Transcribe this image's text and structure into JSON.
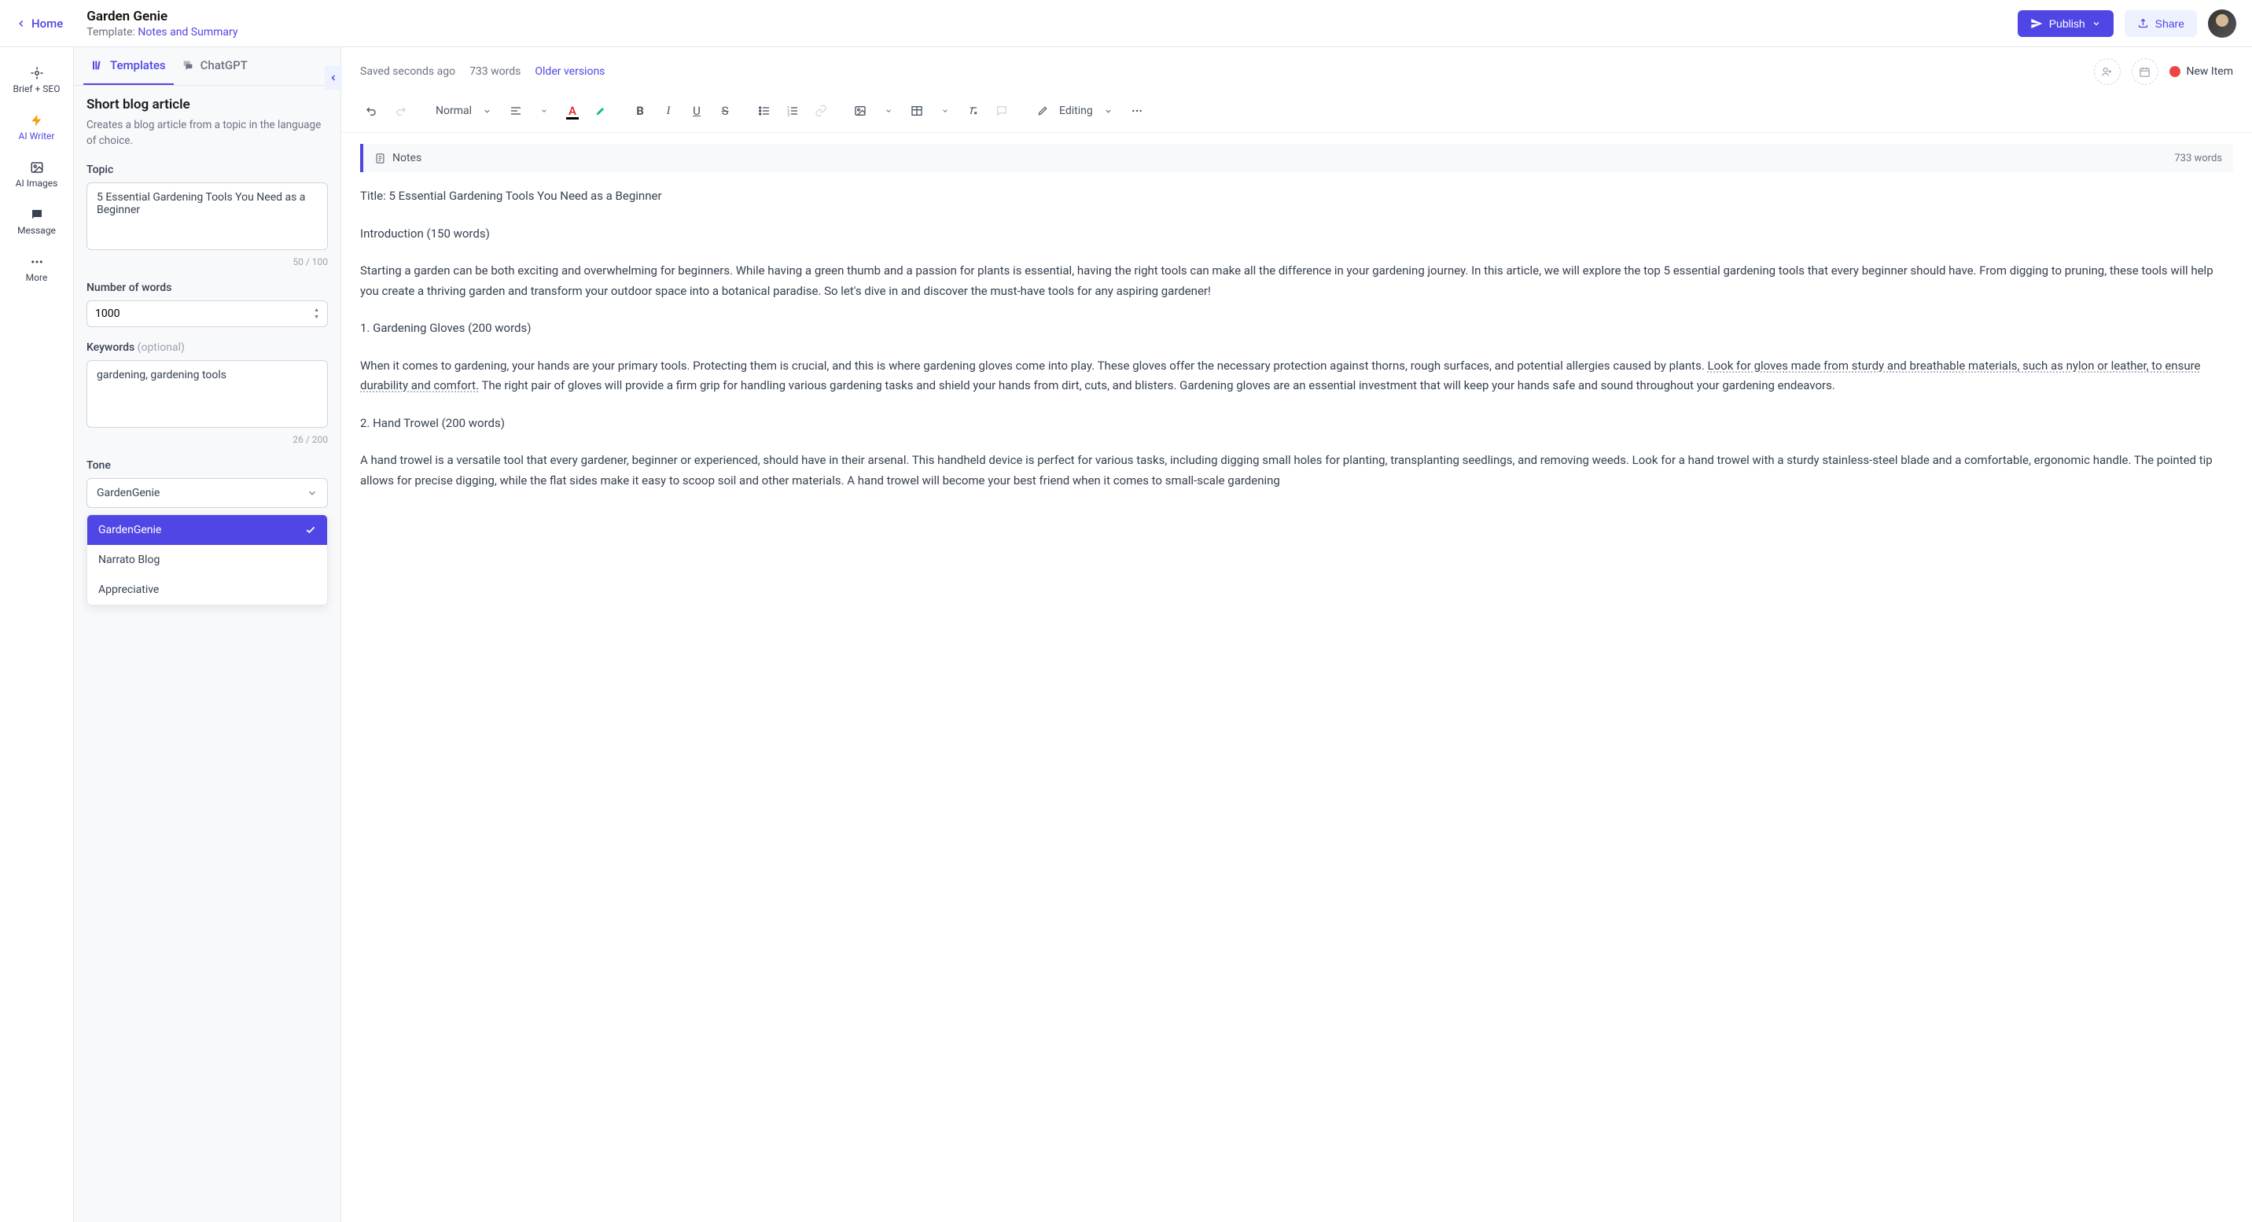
{
  "header": {
    "home": "Home",
    "title": "Garden Genie",
    "template_prefix": "Template: ",
    "template_link": "Notes and Summary",
    "publish": "Publish",
    "share": "Share"
  },
  "mini_sidebar": {
    "items": [
      {
        "label": "Brief + SEO"
      },
      {
        "label": "AI Writer"
      },
      {
        "label": "AI Images"
      },
      {
        "label": "Message"
      },
      {
        "label": "More"
      }
    ]
  },
  "panel": {
    "tabs": {
      "templates": "Templates",
      "chatgpt": "ChatGPT"
    },
    "heading": "Short blog article",
    "description": "Creates a blog article from a topic in the language of choice.",
    "topic_label": "Topic",
    "topic_value": "5 Essential Gardening Tools You Need as a Beginner",
    "topic_counter": "50 / 100",
    "words_label": "Number of words",
    "words_value": "1000",
    "keywords_label": "Keywords",
    "keywords_optional": "(optional)",
    "keywords_value": "gardening, gardening tools",
    "keywords_counter": "26 / 200",
    "tone_label": "Tone",
    "tone_value": "GardenGenie",
    "tone_options": [
      "GardenGenie",
      "Narrato Blog",
      "Appreciative"
    ]
  },
  "editor": {
    "saved_text": "Saved seconds ago",
    "word_count_top": "733 words",
    "older": "Older versions",
    "new_item": "New Item",
    "style_select": "Normal",
    "editing": "Editing",
    "notes_label": "Notes",
    "notes_wc": "733 words"
  },
  "doc": {
    "p1": "Title: 5 Essential Gardening Tools You Need as a Beginner",
    "p2": "Introduction (150 words)",
    "p3": "Starting a garden can be both exciting and overwhelming for beginners. While having a green thumb and a passion for plants is essential, having the right tools can make all the difference in your gardening journey. In this article, we will explore the top 5 essential gardening tools that every beginner should have. From digging to pruning, these tools will help you create a thriving garden and transform your outdoor space into a botanical paradise. So let's dive in and discover the must-have tools for any aspiring gardener!",
    "p4": "1. Gardening Gloves (200 words)",
    "p5a": "When it comes to gardening, your hands are your primary tools. Protecting them is crucial, and this is where gardening gloves come into play. These gloves offer the necessary protection against thorns, rough surfaces, and potential allergies caused by plants. ",
    "p5u": "Look for gloves made from sturdy and breathable materials, such as nylon or leather, to ensure durability and comfort.",
    "p5b": " The right pair of gloves will provide a firm grip for handling various gardening tasks and shield your hands from dirt, cuts, and blisters. Gardening gloves are an essential investment that will keep your hands safe and sound throughout your gardening endeavors.",
    "p6": "2. Hand Trowel (200 words)",
    "p7": "A hand trowel is a versatile tool that every gardener, beginner or experienced, should have in their arsenal. This handheld device is perfect for various tasks, including digging small holes for planting, transplanting seedlings, and removing weeds. Look for a hand trowel with a sturdy stainless-steel blade and a comfortable, ergonomic handle. The pointed tip allows for precise digging, while the flat sides make it easy to scoop soil and other materials. A hand trowel will become your best friend when it comes to small-scale gardening"
  }
}
